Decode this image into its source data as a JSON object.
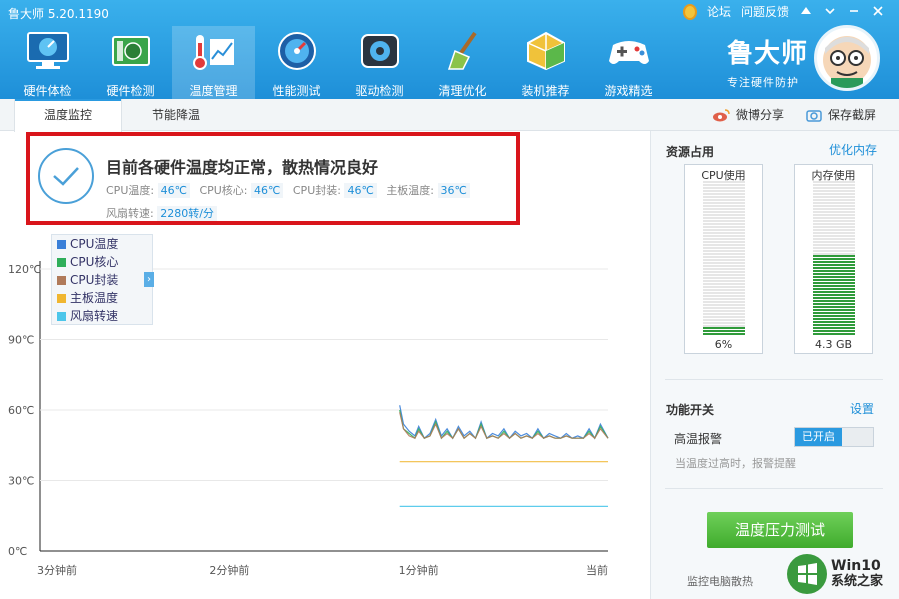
{
  "header": {
    "app_title": "鲁大师 5.20.1190",
    "links": [
      "论坛",
      "问题反馈"
    ],
    "brand_name": "鲁大师",
    "brand_slogan": "专注硬件防护",
    "tools": [
      {
        "label": "硬件体检",
        "icon": "monitor-icon"
      },
      {
        "label": "硬件检测",
        "icon": "circuit-board-icon"
      },
      {
        "label": "温度管理",
        "icon": "thermometer-icon"
      },
      {
        "label": "性能测试",
        "icon": "speedometer-icon"
      },
      {
        "label": "驱动检测",
        "icon": "gear-box-icon"
      },
      {
        "label": "清理优化",
        "icon": "broom-icon"
      },
      {
        "label": "装机推荐",
        "icon": "cube-icon"
      },
      {
        "label": "游戏精选",
        "icon": "gamepad-icon"
      }
    ],
    "active_tool": "温度管理"
  },
  "tabs": {
    "items": [
      "温度监控",
      "节能降温"
    ],
    "active": "温度监控",
    "share": "微博分享",
    "screenshot": "保存截屏"
  },
  "status": {
    "title": "目前各硬件温度均正常，散热情况良好",
    "cpu_temp_label": "CPU温度:",
    "cpu_temp": "46℃",
    "cpu_core_label": "CPU核心:",
    "cpu_core": "46℃",
    "cpu_pkg_label": "CPU封装:",
    "cpu_pkg": "46℃",
    "board_label": "主板温度:",
    "board": "36℃",
    "fan_label": "风扇转速:",
    "fan": "2280转/分"
  },
  "chart_data": {
    "type": "line",
    "y_ticks": [
      "120℃",
      "90℃",
      "60℃",
      "30℃",
      "0℃"
    ],
    "x_ticks": [
      "3分钟前",
      "2分钟前",
      "1分钟前",
      "当前"
    ],
    "ylim": [
      0,
      120
    ],
    "legend": [
      {
        "name": "CPU温度",
        "color": "#3a7fd8"
      },
      {
        "name": "CPU核心",
        "color": "#2fae5a"
      },
      {
        "name": "CPU封装",
        "color": "#b07a5a"
      },
      {
        "name": "主板温度",
        "color": "#f0b630"
      },
      {
        "name": "风扇转速",
        "color": "#4cc6ea"
      }
    ],
    "x_minutes_ago": [
      1.1,
      1.08,
      1.05,
      1.02,
      1.0,
      0.97,
      0.94,
      0.91,
      0.88,
      0.85,
      0.82,
      0.79,
      0.76,
      0.73,
      0.7,
      0.67,
      0.64,
      0.61,
      0.58,
      0.55,
      0.52,
      0.49,
      0.46,
      0.43,
      0.4,
      0.37,
      0.34,
      0.31,
      0.28,
      0.25,
      0.22,
      0.19,
      0.16,
      0.13,
      0.1,
      0.07,
      0.04,
      0.0
    ],
    "series": [
      {
        "name": "CPU温度",
        "color": "#3a7fd8",
        "values": [
          62,
          54,
          51,
          49,
          53,
          48,
          50,
          56,
          49,
          52,
          48,
          53,
          49,
          51,
          48,
          55,
          48,
          50,
          49,
          52,
          48,
          51,
          49,
          50,
          48,
          52,
          48,
          50,
          49,
          48,
          50,
          48,
          49,
          48,
          52,
          48,
          54,
          48
        ]
      },
      {
        "name": "CPU核心",
        "color": "#2fae5a",
        "values": [
          60,
          52,
          50,
          48,
          52,
          48,
          49,
          55,
          48,
          51,
          48,
          52,
          48,
          50,
          48,
          54,
          48,
          49,
          48,
          51,
          48,
          50,
          48,
          49,
          48,
          51,
          48,
          49,
          48,
          48,
          49,
          48,
          48,
          48,
          51,
          48,
          53,
          48
        ]
      },
      {
        "name": "CPU封装",
        "color": "#b07a5a",
        "values": [
          59,
          52,
          49,
          48,
          51,
          48,
          49,
          54,
          48,
          50,
          48,
          52,
          48,
          50,
          48,
          53,
          48,
          49,
          48,
          50,
          48,
          50,
          48,
          49,
          48,
          50,
          48,
          49,
          48,
          48,
          49,
          48,
          48,
          48,
          50,
          48,
          52,
          48
        ]
      },
      {
        "name": "主板温度",
        "color": "#f0b630",
        "values": [
          38,
          38,
          38,
          38,
          38,
          38,
          38,
          38,
          38,
          38,
          38,
          38,
          38,
          38,
          38,
          38,
          38,
          38,
          38,
          38,
          38,
          38,
          38,
          38,
          38,
          38,
          38,
          38,
          38,
          38,
          38,
          38,
          38,
          38,
          38,
          38,
          38,
          38
        ]
      },
      {
        "name": "风扇转速",
        "color": "#4cc6ea",
        "values": [
          19,
          19,
          19,
          19,
          19,
          19,
          19,
          19,
          19,
          19,
          19,
          19,
          19,
          19,
          19,
          19,
          19,
          19,
          19,
          19,
          19,
          19,
          19,
          19,
          19,
          19,
          19,
          19,
          19,
          19,
          19,
          19,
          19,
          19,
          19,
          19,
          19,
          19
        ]
      }
    ]
  },
  "resources": {
    "title": "资源占用",
    "optimize": "优化内存",
    "cpu_label": "CPU使用",
    "cpu_value": "6%",
    "cpu_fraction": 0.06,
    "mem_label": "内存使用",
    "mem_value": "4.3 GB",
    "mem_fraction": 0.52
  },
  "features": {
    "title": "功能开关",
    "settings": "设置",
    "alarm_label": "高温报警",
    "alarm_state": "已开启",
    "alarm_hint": "当温度过高时，报警提醒",
    "stress_button": "温度压力测试",
    "monitor_text": "监控电脑散热"
  },
  "watermark": {
    "line1": "Win10",
    "line2": "系统之家"
  }
}
